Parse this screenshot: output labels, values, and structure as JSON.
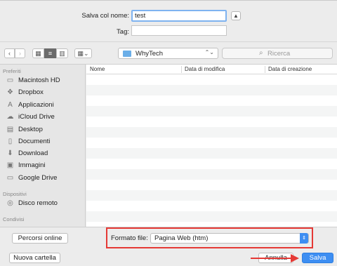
{
  "form": {
    "save_as_label": "Salva col nome:",
    "save_as_value": "test",
    "tag_label": "Tag:",
    "tag_value": ""
  },
  "toolbar": {
    "location": "WhyTech",
    "search_placeholder": "Ricerca"
  },
  "sidebar": {
    "favorites_header": "Preferiti",
    "favorites": [
      {
        "label": "Macintosh HD",
        "icon": "hard-drive-icon"
      },
      {
        "label": "Dropbox",
        "icon": "dropbox-icon"
      },
      {
        "label": "Applicazioni",
        "icon": "applications-icon"
      },
      {
        "label": "iCloud Drive",
        "icon": "cloud-icon"
      },
      {
        "label": "Desktop",
        "icon": "desktop-icon"
      },
      {
        "label": "Documenti",
        "icon": "documents-icon"
      },
      {
        "label": "Download",
        "icon": "download-icon"
      },
      {
        "label": "Immagini",
        "icon": "images-icon"
      },
      {
        "label": "Google Drive",
        "icon": "folder-icon"
      }
    ],
    "devices_header": "Dispositivi",
    "devices": [
      {
        "label": "Disco remoto",
        "icon": "remote-disc-icon"
      }
    ],
    "shared_header": "Condivisi"
  },
  "columns": [
    "Nome",
    "Data di modifica",
    "Data di creazione"
  ],
  "bottom": {
    "online_paths_button": "Percorsi online",
    "format_label": "Formato file:",
    "format_value": "Pagina Web (htm)",
    "new_folder_button": "Nuova cartella",
    "cancel_button": "Annulla",
    "save_button": "Salva"
  },
  "colors": {
    "accent": "#3d8ef2",
    "highlight": "#e53935"
  }
}
